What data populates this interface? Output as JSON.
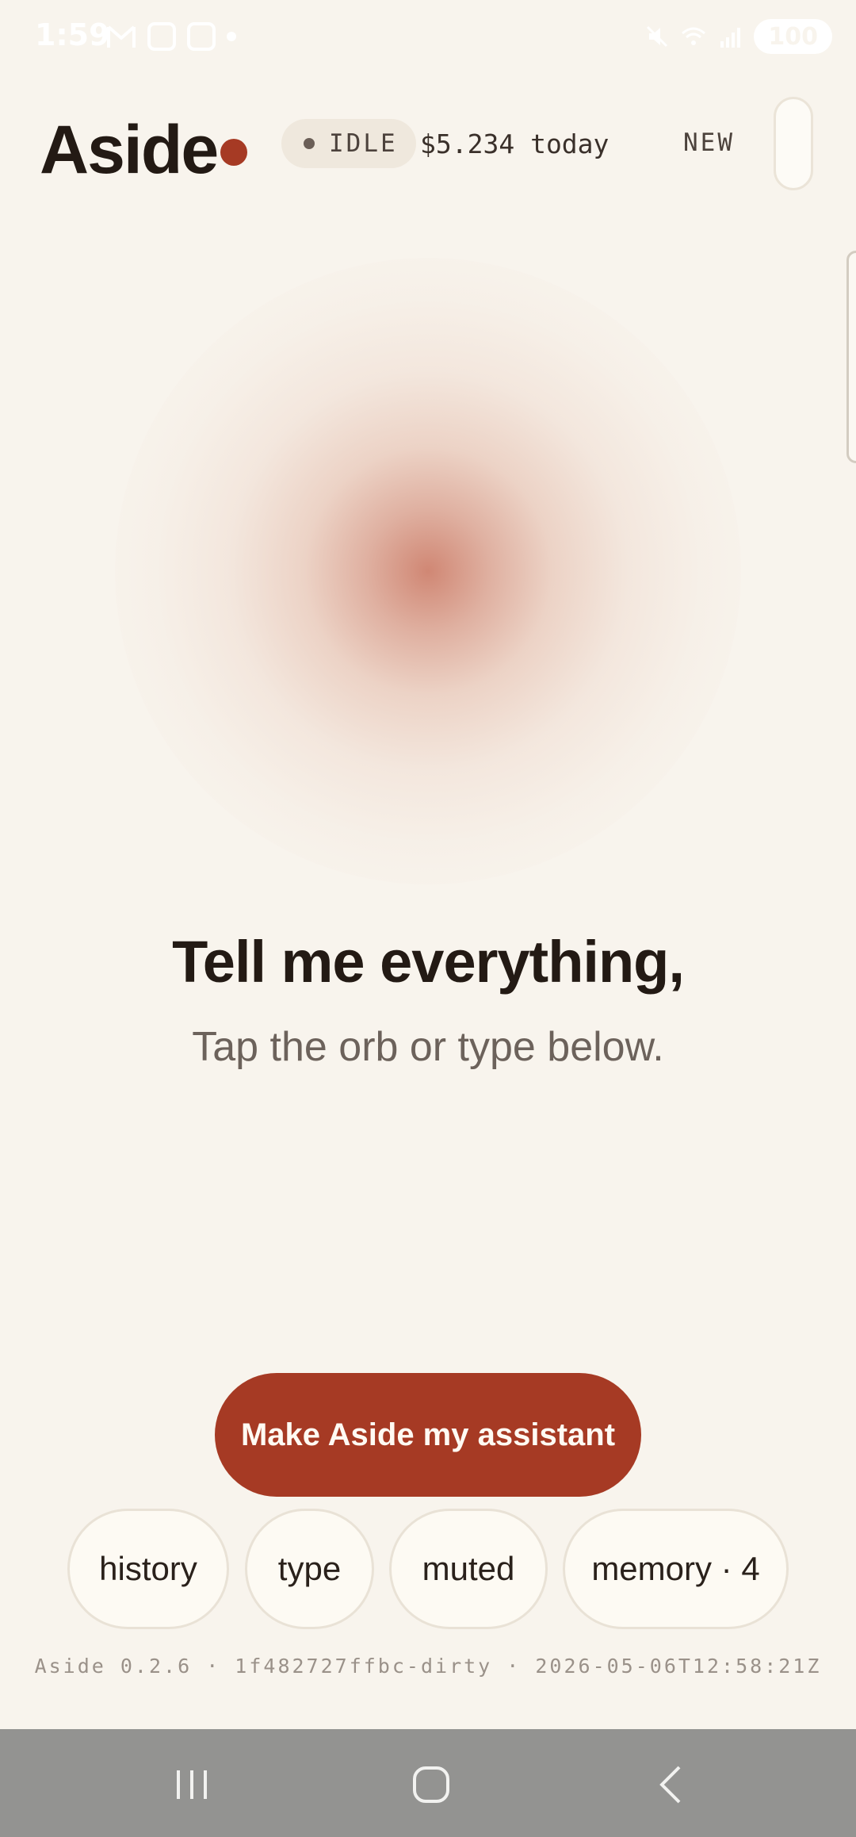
{
  "status_bar": {
    "time": "1:59",
    "battery": "100",
    "icons": [
      "gmail-icon",
      "instagram-icon",
      "instagram-icon",
      "dot-icon",
      "mute-icon",
      "wifi-icon",
      "signal-icon",
      "battery-icon"
    ]
  },
  "header": {
    "logo": "Aside",
    "status_label": "IDLE",
    "cost_label": "$5.234 today",
    "new_label": "NEW"
  },
  "hero": {
    "headline": "Tell me everything,",
    "subline": "Tap the orb or type below."
  },
  "cta": {
    "label": "Make Aside my assistant"
  },
  "chips": [
    {
      "label": "history"
    },
    {
      "label": "type"
    },
    {
      "label": "muted"
    },
    {
      "label": "memory · 4"
    }
  ],
  "footer": {
    "build": "Aside 0.2.6 · 1f482727ffbc-dirty · 2026-05-06T12:58:21Z"
  },
  "nav": {
    "buttons": [
      "recents-icon",
      "home-icon",
      "back-icon"
    ]
  },
  "colors": {
    "background": "#f8f4ed",
    "accent": "#a63a24",
    "text": "#231a14",
    "muted_text": "#6c625b"
  }
}
